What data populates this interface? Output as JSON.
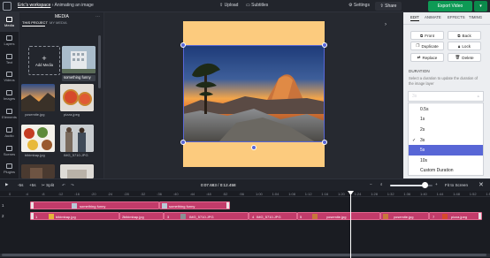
{
  "topbar": {
    "workspace": "Eric's workspace",
    "separator": "›",
    "project_title": "Animating an image",
    "upload": "Upload",
    "subtitles": "Subtitles",
    "settings": "Settings",
    "share": "Share",
    "export": "Export Video"
  },
  "rail": {
    "items": [
      {
        "label": "Media",
        "icon": "media-icon"
      },
      {
        "label": "Layers",
        "icon": "layers-icon"
      },
      {
        "label": "Text",
        "icon": "text-icon"
      },
      {
        "label": "Videos",
        "icon": "videos-icon"
      },
      {
        "label": "Images",
        "icon": "images-icon"
      },
      {
        "label": "Elements",
        "icon": "elements-icon"
      },
      {
        "label": "Audio",
        "icon": "audio-icon"
      },
      {
        "label": "Scenes",
        "icon": "scenes-icon"
      },
      {
        "label": "Plugins",
        "icon": "plugins-icon"
      }
    ]
  },
  "media": {
    "title": "MEDIA",
    "tab_project": "THIS PROJECT",
    "tab_my": "MY MEDIA",
    "add_label": "Add Media",
    "add_plus": "+",
    "thumbs": [
      {
        "caption": "something funny"
      },
      {
        "caption": "yosemite.jpg"
      },
      {
        "caption": "pizza.jpeg"
      },
      {
        "caption": "bibimbap.jpg"
      },
      {
        "caption": "IMG_5710.JPG"
      },
      {
        "caption": ""
      },
      {
        "caption": ""
      }
    ]
  },
  "right": {
    "tabs": [
      "EDIT",
      "ANIMATE",
      "EFFECTS",
      "TIMING"
    ],
    "active_tab": "EDIT",
    "buttons": {
      "front": "Front",
      "back": "Back",
      "duplicate": "Duplicate",
      "lock": "Lock",
      "replace": "Replace",
      "delete": "Delete"
    },
    "duration_title": "DURATION",
    "duration_help": "Select a duration to update the duration of the image layer",
    "duration_value": "3s",
    "options": [
      "0.5s",
      "1s",
      "2s",
      "3s",
      "5s",
      "10s",
      "Custom Duration"
    ],
    "checked": "3s",
    "highlighted": "5s"
  },
  "timeline_bar": {
    "back5": "-5s",
    "fwd5": "+5s",
    "split": "Split",
    "time": "0:07.683 / 0:12.458",
    "fit": "Fit to Screen",
    "zoom_level": 0.82
  },
  "timeline": {
    "ticks": [
      "0",
      ":4",
      ":8",
      ":12",
      ":16",
      ":20",
      ":24",
      ":28",
      ":32",
      ":36",
      ":40",
      ":44",
      ":48",
      ":52",
      ":56",
      "1:00",
      "1:04",
      "1:08",
      "1:12",
      "1:16",
      "1:20",
      "1:24",
      "1:28",
      "1:32",
      "1:36",
      "1:40",
      "1:44",
      "1:48",
      "1:52",
      "1:56"
    ],
    "track1_number": "1",
    "track2_number": "2",
    "track1": [
      {
        "label": "something funny"
      },
      {
        "label": "something funny"
      }
    ],
    "track2": [
      {
        "num": "1",
        "label": "bibimbap.jpg"
      },
      {
        "num": "2",
        "label": "bibimbap.jpg"
      },
      {
        "num": "3",
        "label": "IMG_5710.JPG"
      },
      {
        "num": "4",
        "label": "IMG_5710.JPG"
      },
      {
        "num": "5",
        "label": "yosemite.jpg"
      },
      {
        "num": "6",
        "label": "yosemite.jpg"
      },
      {
        "num": "7",
        "label": "pizza.jpeg"
      }
    ]
  },
  "colors": {
    "accent": "#5866d6",
    "export_green": "#0e9a55",
    "clip_pink": "#c23b6a",
    "frame_bg": "#fccb7e"
  }
}
